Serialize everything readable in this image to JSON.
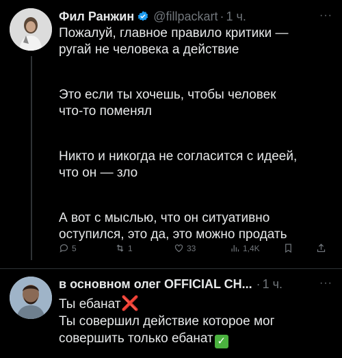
{
  "tweet1": {
    "author_name": "Фил Ранжин",
    "handle": "@fillpackart",
    "separator": "·",
    "time": "1 ч.",
    "more_label": "···",
    "paragraphs": [
      [
        "Пожалуй, главное правило критики —",
        "ругай не человека а действие"
      ],
      [
        "Это если ты хочешь, чтобы человек",
        "что-то поменял"
      ],
      [
        "Никто и никогда не согласится с идеей,",
        "что он — зло"
      ],
      [
        "А вот с мыслью, что он ситуативно",
        "оступился, это да, это можно продать"
      ]
    ],
    "actions": {
      "replies": "5",
      "retweets": "1",
      "likes": "33",
      "views": "1,4K"
    }
  },
  "tweet2": {
    "author_name": "в основном олег OFFICIAL CH...",
    "separator": "·",
    "time": "1 ч.",
    "more_label": "···",
    "line1": "Ты ебанат",
    "line1_emoji": "❌",
    "line2": "Ты совершил действие которое мог",
    "line3": "совершить только ебанат",
    "line3_emoji": "✅"
  },
  "colors": {
    "background": "#000000",
    "text": "#e7e9ea",
    "muted": "#71767b",
    "verified": "#1d9bf0",
    "divider": "#2f3336"
  }
}
